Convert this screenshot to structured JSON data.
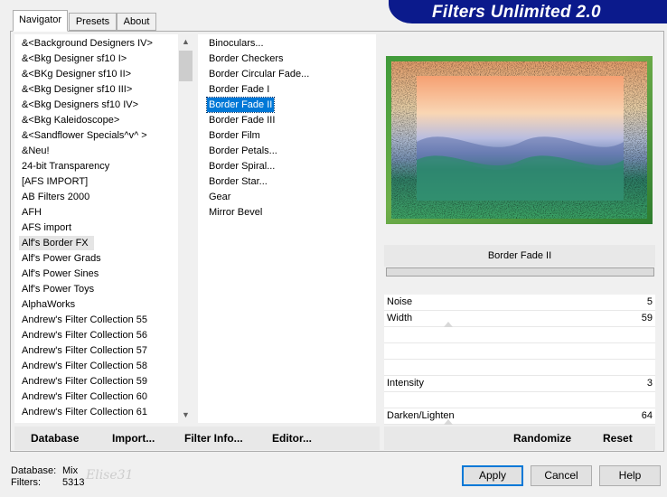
{
  "app": {
    "title": "Filters Unlimited 2.0"
  },
  "tabs": [
    "Navigator",
    "Presets",
    "About"
  ],
  "categories": [
    "&<Background Designers IV>",
    "&<Bkg Designer sf10 I>",
    "&<BKg Designer sf10 II>",
    "&<Bkg Designer sf10 III>",
    "&<Bkg Designers sf10 IV>",
    "&<Bkg Kaleidoscope>",
    "&<Sandflower Specials^v^ >",
    "&Neu!",
    "24-bit Transparency",
    "[AFS IMPORT]",
    "AB Filters 2000",
    "AFH",
    "AFS import",
    "Alf's Border FX",
    "Alf's Power Grads",
    "Alf's Power Sines",
    "Alf's Power Toys",
    "AlphaWorks",
    "Andrew's Filter Collection 55",
    "Andrew's Filter Collection 56",
    "Andrew's Filter Collection 57",
    "Andrew's Filter Collection 58",
    "Andrew's Filter Collection 59",
    "Andrew's Filter Collection 60",
    "Andrew's Filter Collection 61"
  ],
  "hovered_category": "Alf's Border FX",
  "filters": [
    "Binoculars...",
    "Border Checkers",
    "Border Circular Fade...",
    "Border Fade I",
    "Border Fade II",
    "Border Fade III",
    "Border Film",
    "Border Petals...",
    "Border Spiral...",
    "Border Star...",
    "Gear",
    "Mirror Bevel"
  ],
  "selected_filter": "Border Fade II",
  "filter_name": "Border Fade II",
  "params": [
    {
      "label": "Noise",
      "value": "5"
    },
    {
      "label": "Width",
      "value": "59"
    },
    {
      "label": "Intensity",
      "value": "3"
    },
    {
      "label": "Darken/Lighten",
      "value": "64"
    }
  ],
  "toolbar": {
    "database": "Database",
    "import": "Import...",
    "filter_info": "Filter Info...",
    "editor": "Editor...",
    "randomize": "Randomize",
    "reset": "Reset"
  },
  "status": {
    "database_label": "Database:",
    "database_value": "Mix",
    "filters_label": "Filters:",
    "filters_value": "5313"
  },
  "watermark": "Elise31",
  "buttons": {
    "apply": "Apply",
    "cancel": "Cancel",
    "help": "Help"
  },
  "colors": {
    "banner": "#0b1a8c",
    "selection": "#0078d7"
  }
}
